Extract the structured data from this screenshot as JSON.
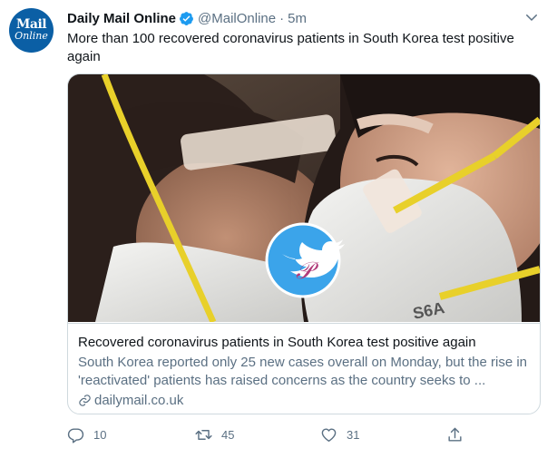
{
  "account": {
    "avatar_line1": "Mail",
    "avatar_line2": "Online",
    "name": "Daily Mail Online",
    "handle": "@MailOnline",
    "separator": "·",
    "time": "5m"
  },
  "tweet": {
    "text": "More than 100 recovered coronavirus patients in South Korea test positive again"
  },
  "card": {
    "title": "Recovered coronavirus patients in South Korea test positive again",
    "description": "South Korea reported only 25 new cases overall on Monday, but the rise in 'reactivated' patients has raised concerns as the country seeks to ...",
    "domain": "dailymail.co.uk",
    "mask_text": "S6A"
  },
  "actions": {
    "reply_count": "10",
    "retweet_count": "45",
    "like_count": "31"
  },
  "icons": {
    "verified": "verified-badge-icon",
    "more": "chevron-down-icon",
    "link": "link-icon",
    "reply": "reply-icon",
    "retweet": "retweet-icon",
    "like": "heart-icon",
    "share": "share-icon",
    "watermark": "twitter-bird-watermark-icon"
  },
  "colors": {
    "verified": "#1d9bf0",
    "text": "#0f1419",
    "secondary": "#5b7083",
    "border": "#cfd9de",
    "avatar_bg": "#0b5fa5",
    "mask_strap": "#e8d02a"
  }
}
